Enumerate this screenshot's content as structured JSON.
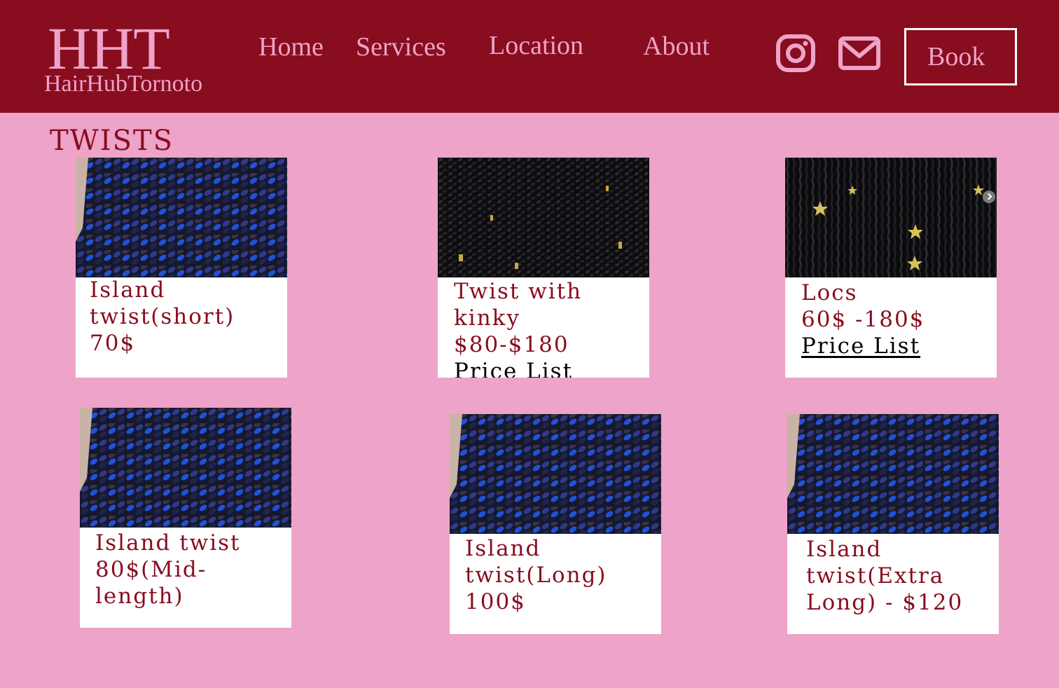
{
  "brand": {
    "mark": "HHT",
    "name": "HairHubTornoto"
  },
  "nav": {
    "home": "Home",
    "services": "Services",
    "location": "Location",
    "about": "About"
  },
  "header_icons": {
    "instagram": "instagram-icon",
    "email": "mail-icon"
  },
  "book_label": "Book",
  "section": {
    "title": "TWISTS"
  },
  "cards": [
    {
      "title": "Island\ntwist(short)",
      "price": "70$",
      "photo": "blue-black twists"
    },
    {
      "title": "Twist with\nkinky",
      "price": "$80-$180",
      "link": "Price List",
      "photo": "black twists with gold charms"
    },
    {
      "title": "Locs",
      "price": "60$ -180$",
      "link": "Price List",
      "photo": "black locs with gold star charms"
    },
    {
      "title": "Island twist\n80$(Mid-\nlength)",
      "photo": "blue-black twists"
    },
    {
      "title": "Island\ntwist(Long)",
      "price": "100$",
      "photo": "blue-black twists"
    },
    {
      "title": "Island\ntwist(Extra\nLong) - $120",
      "photo": "blue-black twists"
    }
  ],
  "colors": {
    "header_bg": "#880D1F",
    "page_bg": "#EEA3C8",
    "accent_text": "#880D1F",
    "card_bg": "#FFFFFF"
  }
}
